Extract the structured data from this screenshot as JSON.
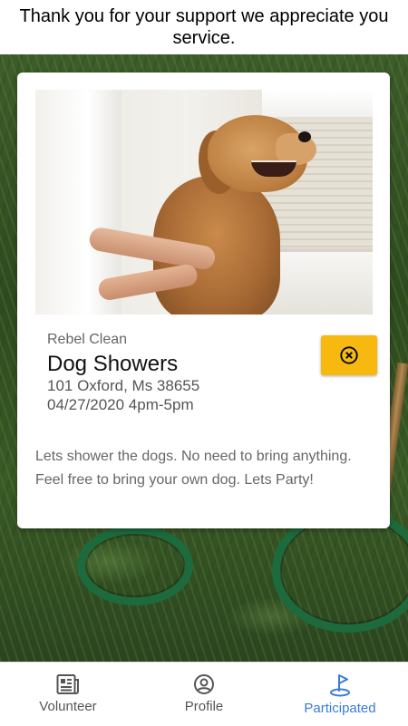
{
  "header": {
    "message": "Thank you for your support we appreciate you service."
  },
  "event": {
    "organization": "Rebel Clean",
    "title": "Dog Showers",
    "address": "101 Oxford, Ms 38655",
    "datetime": "04/27/2020 4pm-5pm",
    "description": "Lets shower the dogs. No need to bring anything. Feel free to bring your own dog. Lets Party!",
    "cancel_icon": "close-circle-icon",
    "cancel_color": "#f7b90f"
  },
  "nav": {
    "items": [
      {
        "label": "Volunteer",
        "icon": "newspaper-icon",
        "active": false
      },
      {
        "label": "Profile",
        "icon": "account-circle-icon",
        "active": false
      },
      {
        "label": "Participated",
        "icon": "golf-flag-icon",
        "active": true
      }
    ],
    "active_color": "#3a7bdc",
    "inactive_color": "#555555"
  }
}
